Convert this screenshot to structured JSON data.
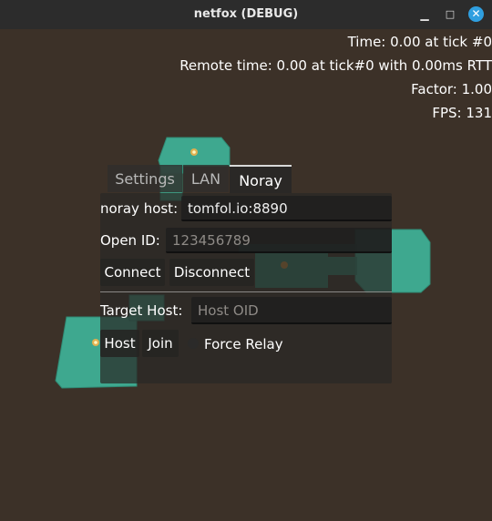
{
  "window": {
    "title": "netfox (DEBUG)"
  },
  "stats": {
    "time": "Time: 0.00 at tick #0",
    "remote_time": "Remote time: 0.00 at tick#0 with 0.00ms RTT",
    "factor": "Factor: 1.00",
    "fps": "FPS: 131"
  },
  "tabs": [
    {
      "label": "Settings",
      "active": false
    },
    {
      "label": "LAN",
      "active": false
    },
    {
      "label": "Noray",
      "active": true
    }
  ],
  "noray": {
    "host_label": "noray host:",
    "host_value": "tomfol.io:8890",
    "open_id_label": "Open ID:",
    "open_id_placeholder": "123456789",
    "connect_label": "Connect",
    "disconnect_label": "Disconnect",
    "target_host_label": "Target Host:",
    "target_host_placeholder": "Host OID",
    "host_button": "Host",
    "join_button": "Join",
    "force_relay_label": "Force Relay",
    "force_relay_checked": false
  },
  "colors": {
    "background": "#3c3128",
    "map_teal": "#3ea88f",
    "accent_close": "#2f9fe0"
  }
}
